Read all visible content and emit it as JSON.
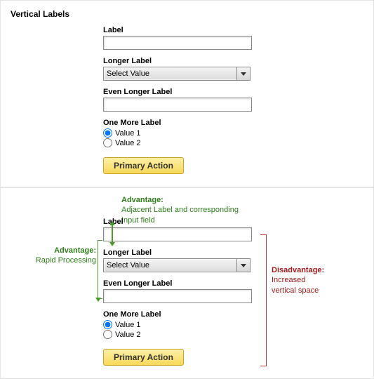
{
  "panel1": {
    "title": "Vertical Labels",
    "fields": {
      "text": {
        "label": "Label"
      },
      "select": {
        "label": "Longer Label",
        "value": "Select Value"
      },
      "text2": {
        "label": "Even Longer Label"
      },
      "radio": {
        "label": "One More Label",
        "option1": "Value 1",
        "option2": "Value 2"
      }
    },
    "button": "Primary Action"
  },
  "panel2": {
    "anno_top": {
      "title": "Advantage:",
      "text": "Adjacent Label and corresponding Input field"
    },
    "anno_left": {
      "title": "Advantage:",
      "text": "Rapid Processing"
    },
    "anno_right": {
      "title": "Disadvantage:",
      "text": "Increased vertical space"
    },
    "fields": {
      "text": {
        "label": "Label"
      },
      "select": {
        "label": "Longer Label",
        "value": "Select Value"
      },
      "text2": {
        "label": "Even Longer Label"
      },
      "radio": {
        "label": "One More Label",
        "option1": "Value 1",
        "option2": "Value 2"
      }
    },
    "button": "Primary Action"
  }
}
